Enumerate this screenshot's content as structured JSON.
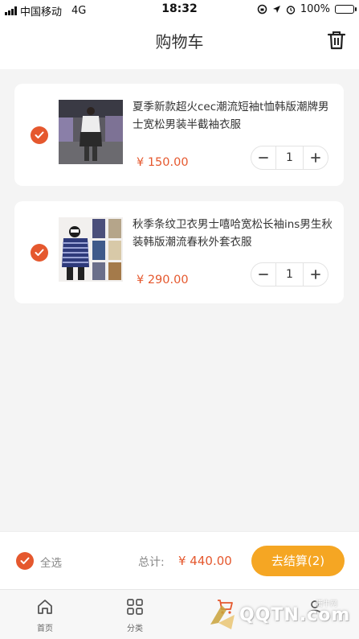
{
  "status_bar": {
    "carrier": "中国移动",
    "network": "4G",
    "time": "18:32",
    "battery": "100%"
  },
  "nav": {
    "title": "购物车"
  },
  "cart": {
    "items": [
      {
        "title": "夏季新款超火cec潮流短袖t恤韩版潮牌男士宽松男装半截袖衣服",
        "price": "¥ 150.00",
        "quantity": "1",
        "checked": true
      },
      {
        "title": "秋季条纹卫衣男士嘻哈宽松长袖ins男生秋装韩版潮流春秋外套衣服",
        "price": "¥ 290.00",
        "quantity": "1",
        "checked": true
      }
    ]
  },
  "footer": {
    "select_all_label": "全选",
    "total_label": "总计:",
    "total_value": "¥ 440.00",
    "checkout_label": "去结算(2)"
  },
  "tab_bar": {
    "tabs": [
      {
        "label": "首页",
        "icon": "home-icon"
      },
      {
        "label": "分类",
        "icon": "category-grid-icon"
      },
      {
        "label": "",
        "icon": "cart-icon"
      },
      {
        "label": "",
        "icon": "profile-icon"
      }
    ]
  },
  "watermark": {
    "brand": "QQTN.com",
    "site": "腾牛网"
  },
  "colors": {
    "accent": "#e5582e",
    "checkout": "#f5a623",
    "background": "#f4f4f4"
  }
}
